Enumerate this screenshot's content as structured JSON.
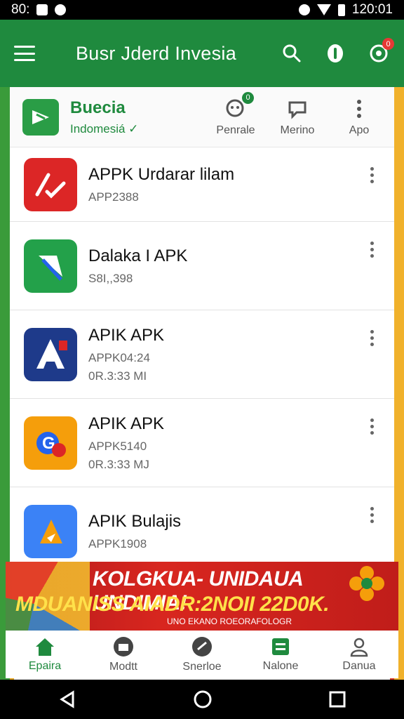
{
  "status_bar": {
    "left_text": "80:",
    "time": "120:01"
  },
  "app_bar": {
    "title": "Busr Jderd Invesia"
  },
  "header": {
    "brand": "Buecia",
    "subtitle": "Indomesiá ✓",
    "actions": [
      {
        "label": "Penrale",
        "badge": "0"
      },
      {
        "label": "Merino"
      },
      {
        "label": "Apo"
      }
    ]
  },
  "apps": [
    {
      "title": "APPK Urdarar lilam",
      "sub": "APP2388",
      "sub2": "",
      "icon_color": "#dc2626"
    },
    {
      "title": "Dalaka I APK",
      "sub": "S8I,,398",
      "sub2": "",
      "icon_color": "#23a14a"
    },
    {
      "title": "APIK APK",
      "sub": "APPK04:24",
      "sub2": "0R.3:33 MI",
      "icon_color": "#1e3a8a"
    },
    {
      "title": "APIK APK",
      "sub": "APPK5140",
      "sub2": "0R.3:33 MJ",
      "icon_color": "#f59e0b"
    },
    {
      "title": "APIK Bulajis",
      "sub": "APPK1908",
      "sub2": "",
      "icon_color": "#3b82f6"
    }
  ],
  "banner": {
    "line1": "KOLGKUA- UNIDAUA UNDIMIA!",
    "line2": "MDUANISS AIADR:2NOII  22D0K.",
    "line3": "UNO EKANO ROEORAFOLOGR"
  },
  "bottom_nav": [
    {
      "label": "Epaira",
      "icon": "home-icon",
      "active": true
    },
    {
      "label": "Modtt",
      "icon": "store-icon"
    },
    {
      "label": "Snerloe",
      "icon": "speed-icon"
    },
    {
      "label": "Nalone",
      "icon": "list-icon"
    },
    {
      "label": "Danua",
      "icon": "person-icon"
    }
  ],
  "colors": {
    "primary": "#1f8a3e",
    "accent_red": "#e53935"
  }
}
